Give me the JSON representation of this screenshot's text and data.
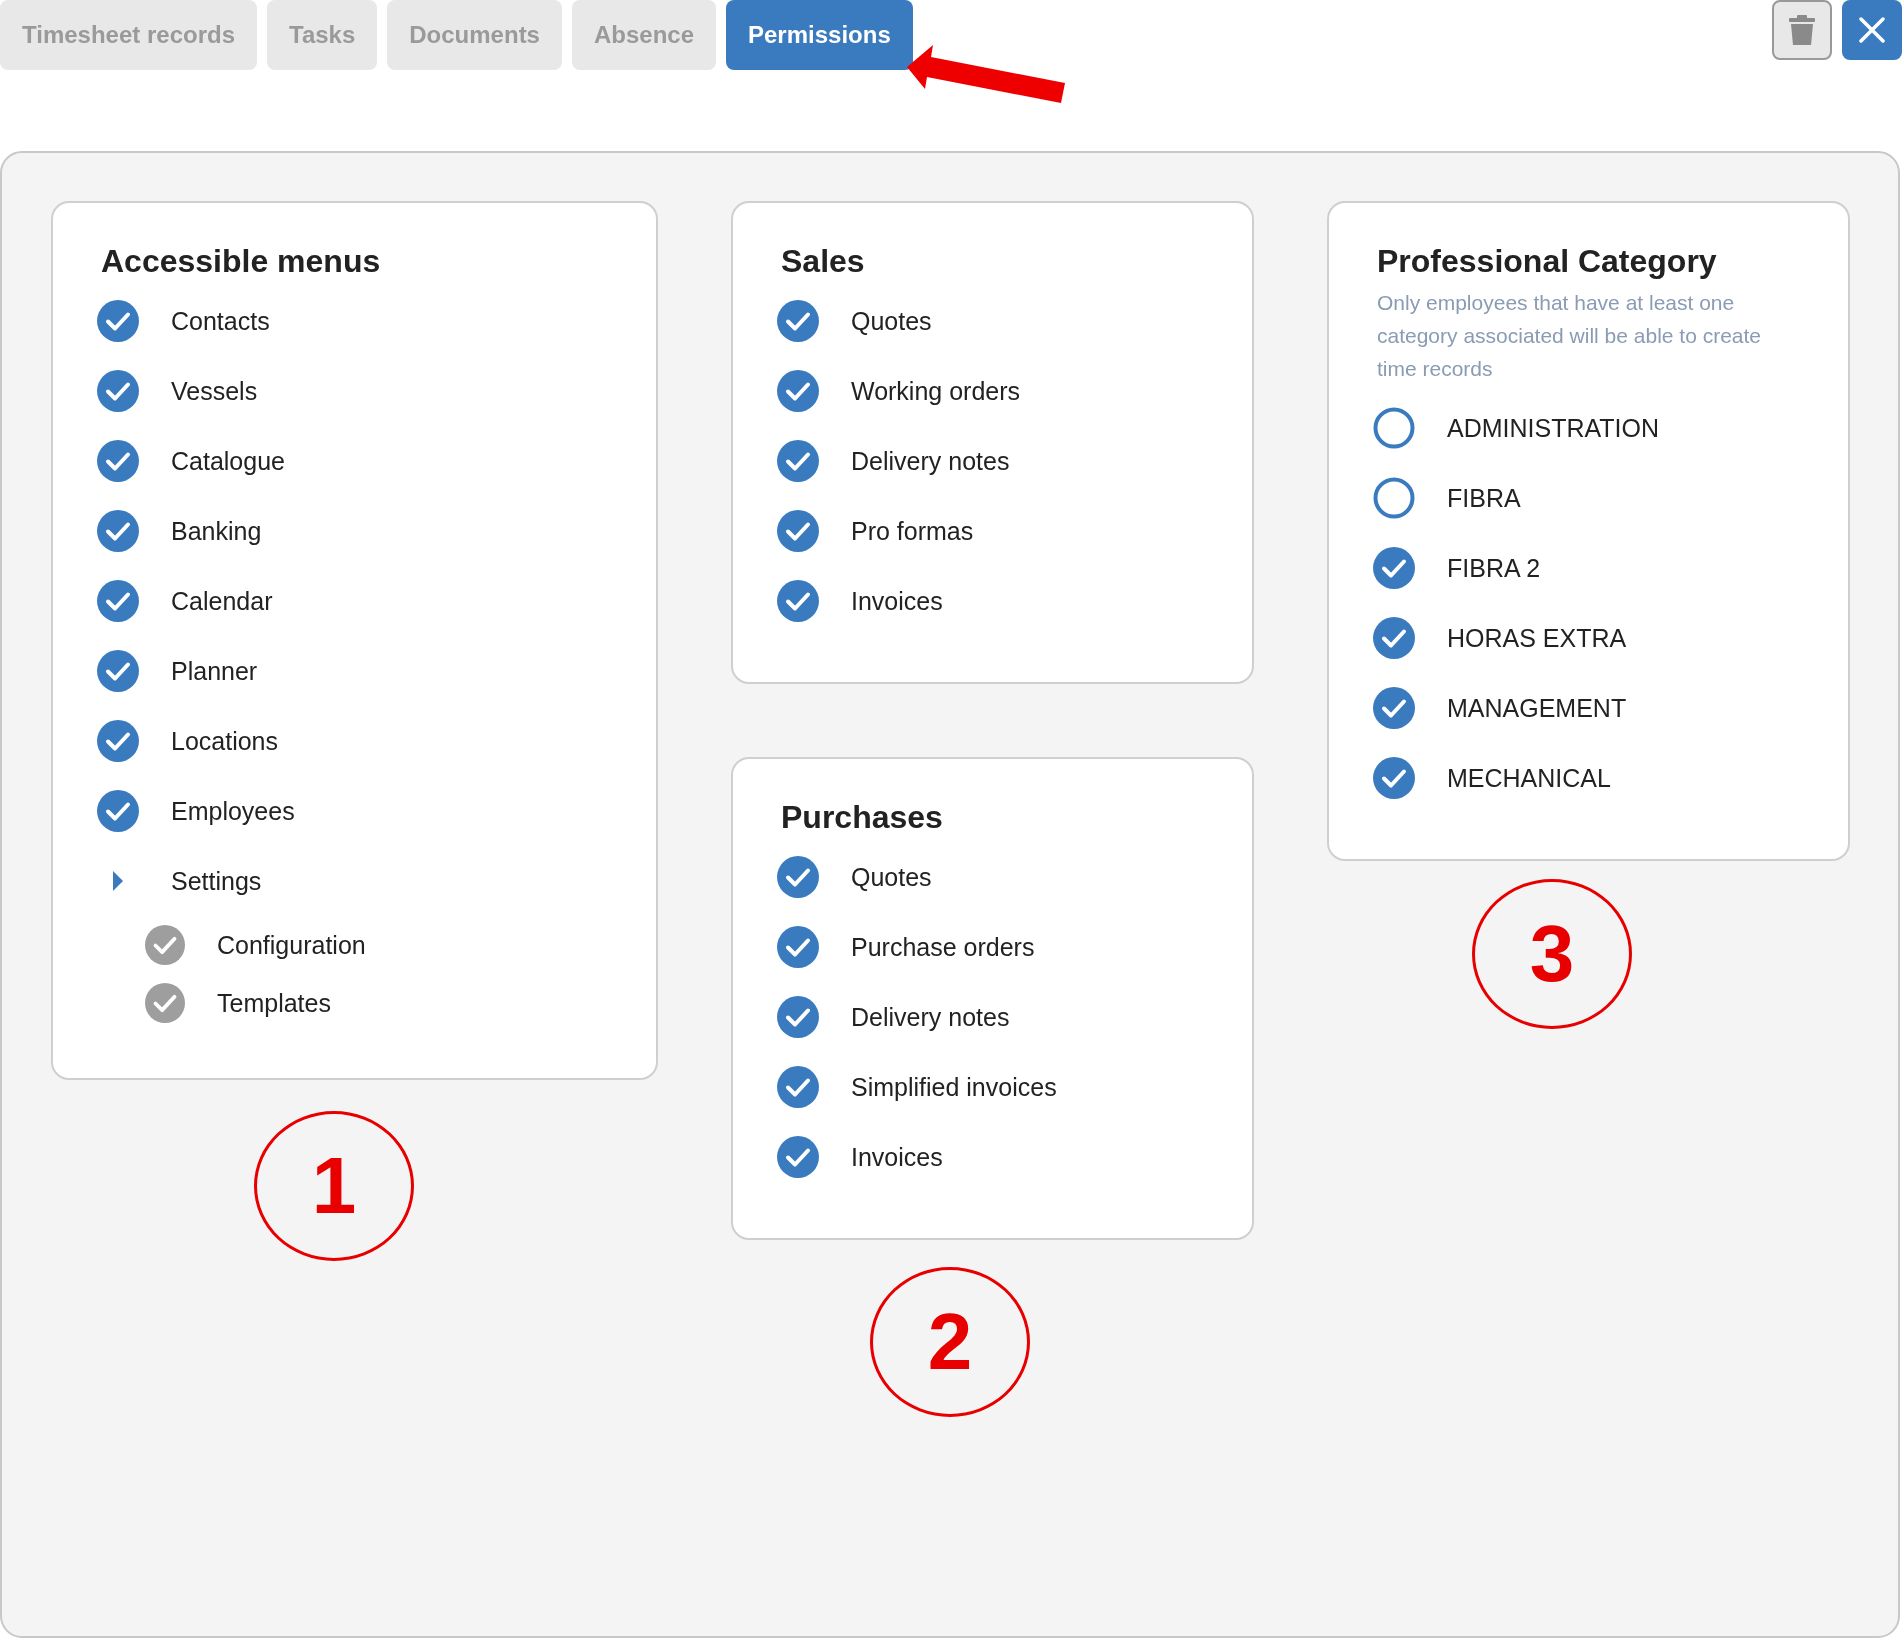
{
  "tabs": [
    {
      "label": "Timesheet records",
      "selected": false
    },
    {
      "label": "Tasks",
      "selected": false
    },
    {
      "label": "Documents",
      "selected": false
    },
    {
      "label": "Absence",
      "selected": false
    },
    {
      "label": "Permissions",
      "selected": true
    }
  ],
  "accessible_menus": {
    "title": "Accessible menus",
    "items": [
      {
        "kind": "check",
        "label": "Contacts",
        "checked": true
      },
      {
        "kind": "check",
        "label": "Vessels",
        "checked": true
      },
      {
        "kind": "check",
        "label": "Catalogue",
        "checked": true
      },
      {
        "kind": "check",
        "label": "Banking",
        "checked": true
      },
      {
        "kind": "check",
        "label": "Calendar",
        "checked": true
      },
      {
        "kind": "check",
        "label": "Planner",
        "checked": true
      },
      {
        "kind": "check",
        "label": "Locations",
        "checked": true
      },
      {
        "kind": "check",
        "label": "Employees",
        "checked": true
      },
      {
        "kind": "group",
        "label": "Settings",
        "children": [
          {
            "label": "Configuration",
            "checked": true,
            "disabled": true
          },
          {
            "label": "Templates",
            "checked": true,
            "disabled": true
          }
        ]
      }
    ]
  },
  "sales": {
    "title": "Sales",
    "items": [
      {
        "label": "Quotes",
        "checked": true
      },
      {
        "label": "Working orders",
        "checked": true
      },
      {
        "label": "Delivery notes",
        "checked": true
      },
      {
        "label": "Pro formas",
        "checked": true
      },
      {
        "label": "Invoices",
        "checked": true
      }
    ]
  },
  "purchases": {
    "title": "Purchases",
    "items": [
      {
        "label": "Quotes",
        "checked": true
      },
      {
        "label": "Purchase orders",
        "checked": true
      },
      {
        "label": "Delivery notes",
        "checked": true
      },
      {
        "label": "Simplified invoices",
        "checked": true
      },
      {
        "label": "Invoices",
        "checked": true
      }
    ]
  },
  "professional_category": {
    "title": "Professional Category",
    "description": "Only employees that have at least one category associated will be able to create time records",
    "items": [
      {
        "label": "ADMINISTRATION",
        "checked": false
      },
      {
        "label": "FIBRA",
        "checked": false
      },
      {
        "label": "FIBRA 2",
        "checked": true
      },
      {
        "label": "HORAS EXTRA",
        "checked": true
      },
      {
        "label": "MANAGEMENT",
        "checked": true
      },
      {
        "label": "MECHANICAL",
        "checked": true
      }
    ]
  },
  "annotations": [
    {
      "label": "1"
    },
    {
      "label": "2"
    },
    {
      "label": "3"
    }
  ]
}
